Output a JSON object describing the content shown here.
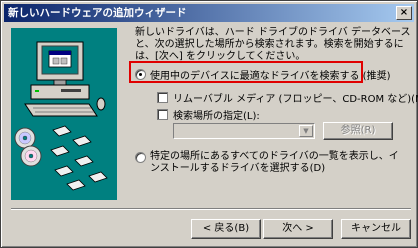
{
  "window": {
    "title": "新しいハードウェアの追加ウィザード",
    "close_label": "×"
  },
  "description": "新しいドライバは、ハード ドライブのドライバ データベースと、次の選択した場所から検索されます。検索を開始するには、[次へ] をクリックしてください。",
  "options": {
    "search_best_label": "使用中のデバイスに最適なドライバを検索する (推奨)",
    "removable_media_label": "リムーバブル メディア (フロッピー、CD-ROM など)(M)",
    "specify_location_label": "検索場所の指定(L):",
    "location_path_value": "",
    "browse_label": "参照(R)",
    "select_list_label": "特定の場所にあるすべてのドライバの一覧を表示し、インストールするドライバを選択する(D)"
  },
  "buttons": {
    "back_label": "< 戻る(B)",
    "next_label": "次へ >",
    "cancel_label": "キャンセル"
  },
  "colors": {
    "panel_bg": "#008080",
    "highlight_border": "#e00000",
    "title_start": "#0a246a",
    "title_end": "#a6caf0"
  },
  "icons": [
    "computer-icon",
    "cd-discs-icon",
    "floppy-disks-icon",
    "close-icon"
  ]
}
